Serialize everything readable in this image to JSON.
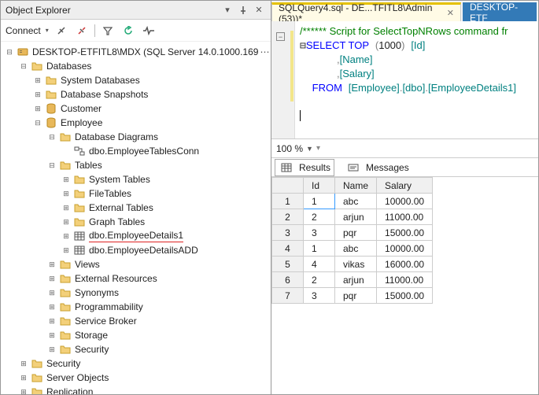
{
  "explorer": {
    "title": "Object Explorer",
    "connect_label": "Connect",
    "server": "DESKTOP-ETFITL8\\MDX (SQL Server 14.0.1000.169",
    "nodes": {
      "databases": "Databases",
      "system_databases": "System Databases",
      "database_snapshots": "Database Snapshots",
      "customer": "Customer",
      "employee": "Employee",
      "database_diagrams": "Database Diagrams",
      "dbo_employeetablesconn": "dbo.EmployeeTablesConn",
      "tables": "Tables",
      "system_tables": "System Tables",
      "filetables": "FileTables",
      "external_tables": "External Tables",
      "graph_tables": "Graph Tables",
      "dbo_employeedetails1": "dbo.EmployeeDetails1",
      "dbo_employeedetailsadd": "dbo.EmployeeDetailsADD",
      "views": "Views",
      "external_resources": "External Resources",
      "synonyms": "Synonyms",
      "programmability": "Programmability",
      "service_broker": "Service Broker",
      "storage": "Storage",
      "security_inner": "Security",
      "security": "Security",
      "server_objects": "Server Objects",
      "replication": "Replication"
    }
  },
  "tabs": {
    "active": "SQLQuery4.sql - DE...TFITL8\\Admin (53))*",
    "other": "DESKTOP-ETF"
  },
  "sql": {
    "comment": "/****** Script for SelectTopNRows command fr",
    "select": "SELECT",
    "top": " TOP",
    "topnum": "1000",
    "id": "[Id]",
    "name": "[Name]",
    "salary": "[Salary]",
    "from": "FROM",
    "tbl_a": "[Employee]",
    "tbl_b": "[dbo]",
    "tbl_c": "[EmployeeDetails1]"
  },
  "zoom": "100 %",
  "result_tabs": {
    "results": "Results",
    "messages": "Messages"
  },
  "grid": {
    "cols": [
      "Id",
      "Name",
      "Salary"
    ],
    "rows": [
      {
        "n": "1",
        "Id": "1",
        "Name": "abc",
        "Salary": "10000.00"
      },
      {
        "n": "2",
        "Id": "2",
        "Name": "arjun",
        "Salary": "11000.00"
      },
      {
        "n": "3",
        "Id": "3",
        "Name": "pqr",
        "Salary": "15000.00"
      },
      {
        "n": "4",
        "Id": "1",
        "Name": "abc",
        "Salary": "10000.00"
      },
      {
        "n": "5",
        "Id": "4",
        "Name": "vikas",
        "Salary": "16000.00"
      },
      {
        "n": "6",
        "Id": "2",
        "Name": "arjun",
        "Salary": "11000.00"
      },
      {
        "n": "7",
        "Id": "3",
        "Name": "pqr",
        "Salary": "15000.00"
      }
    ]
  }
}
